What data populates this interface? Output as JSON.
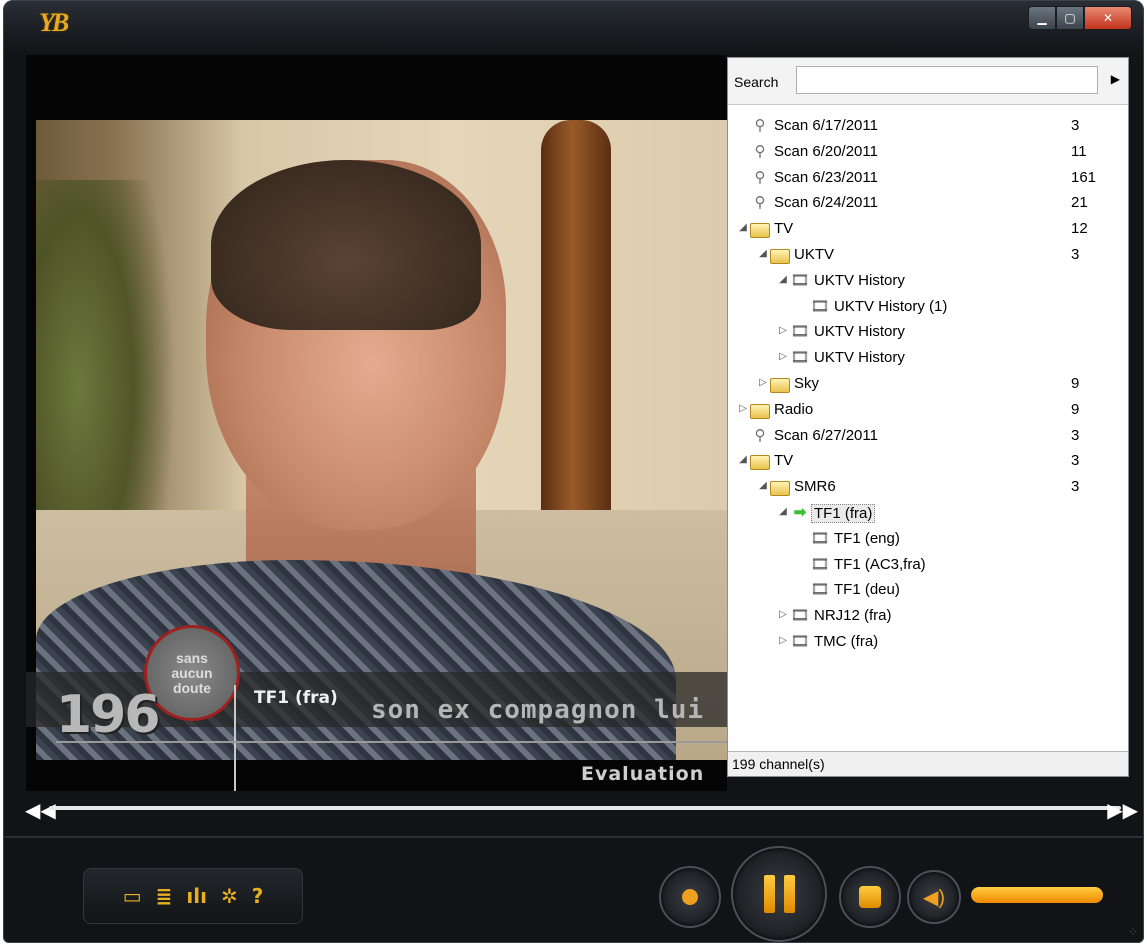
{
  "window": {
    "logo_text": "YB",
    "buttons": {
      "minimize": "▁",
      "maximize": "▢",
      "close": "✕"
    }
  },
  "video": {
    "channel_number": "196",
    "channel_name": "TF1 (fra)",
    "logo_lines": [
      "sans",
      "aucun",
      "doute"
    ],
    "subtitle": "son ex compagnon lui",
    "watermark": "Evaluation"
  },
  "panel": {
    "search_label": "Search",
    "search_value": "",
    "tree": [
      {
        "label": "Scan 6/17/2011",
        "count": "3",
        "icon": "satellite-icon",
        "level": 0,
        "toggle": ""
      },
      {
        "label": "Scan 6/20/2011",
        "count": "11",
        "icon": "satellite-icon",
        "level": 0,
        "toggle": ""
      },
      {
        "label": "Scan 6/23/2011",
        "count": "161",
        "icon": "satellite-icon",
        "level": 0,
        "toggle": ""
      },
      {
        "label": "Scan 6/24/2011",
        "count": "21",
        "icon": "satellite-icon",
        "level": 0,
        "toggle": ""
      },
      {
        "label": "TV",
        "count": "12",
        "icon": "folder-icon",
        "level": 0,
        "toggle": "expanded"
      },
      {
        "label": "UKTV",
        "count": "3",
        "icon": "folder-icon",
        "level": 1,
        "toggle": "expanded"
      },
      {
        "label": "UKTV History",
        "count": "",
        "icon": "film-icon",
        "level": 2,
        "toggle": "expanded"
      },
      {
        "label": "UKTV History (1)",
        "count": "",
        "icon": "film-icon",
        "level": 3,
        "toggle": ""
      },
      {
        "label": "UKTV History",
        "count": "",
        "icon": "film-icon",
        "level": 2,
        "toggle": "collapsed"
      },
      {
        "label": "UKTV History",
        "count": "",
        "icon": "film-icon",
        "level": 2,
        "toggle": "collapsed"
      },
      {
        "label": "Sky",
        "count": "9",
        "icon": "folder-icon",
        "level": 1,
        "toggle": "collapsed"
      },
      {
        "label": "Radio",
        "count": "9",
        "icon": "folder-icon",
        "level": 0,
        "toggle": "collapsed"
      },
      {
        "label": "Scan 6/27/2011",
        "count": "3",
        "icon": "satellite-icon",
        "level": 0,
        "toggle": ""
      },
      {
        "label": "TV",
        "count": "3",
        "icon": "folder-icon",
        "level": 0,
        "toggle": "expanded"
      },
      {
        "label": "SMR6",
        "count": "3",
        "icon": "folder-icon",
        "level": 1,
        "toggle": "expanded"
      },
      {
        "label": "TF1 (fra)",
        "count": "",
        "icon": "play-arrow-icon",
        "level": 2,
        "toggle": "expanded",
        "selected": true
      },
      {
        "label": "TF1 (eng)",
        "count": "",
        "icon": "film-icon",
        "level": 3,
        "toggle": ""
      },
      {
        "label": "TF1 (AC3,fra)",
        "count": "",
        "icon": "film-icon",
        "level": 3,
        "toggle": ""
      },
      {
        "label": "TF1 (deu)",
        "count": "",
        "icon": "film-icon",
        "level": 3,
        "toggle": ""
      },
      {
        "label": "NRJ12 (fra)",
        "count": "",
        "icon": "film-icon",
        "level": 2,
        "toggle": "collapsed"
      },
      {
        "label": "TMC (fra)",
        "count": "",
        "icon": "film-icon",
        "level": 2,
        "toggle": "collapsed"
      }
    ],
    "status": "199 channel(s)"
  },
  "controls": {
    "toolbar": [
      "folder-icon",
      "playlist-icon",
      "equalizer-icon",
      "settings-icon",
      "help-icon"
    ],
    "volume_level": 1.0,
    "colors": {
      "accent": "#f0a020",
      "panel_bg": "#ffffff",
      "window_bg": "#111316"
    }
  }
}
